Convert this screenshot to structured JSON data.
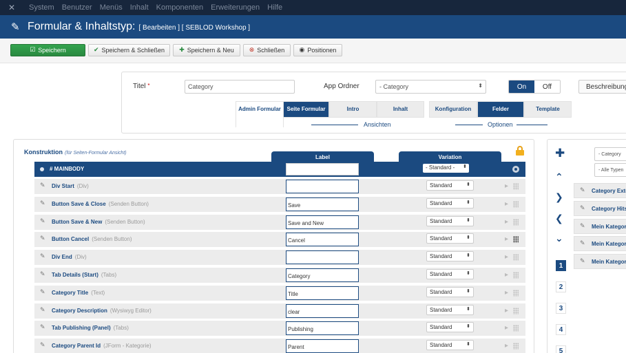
{
  "topnav": {
    "items": [
      "System",
      "Benutzer",
      "Menüs",
      "Inhalt",
      "Komponenten",
      "Erweiterungen",
      "Hilfe"
    ]
  },
  "header": {
    "icon": "pen-icon",
    "title": "Formular & Inhaltstyp:",
    "subtitle": "[ Bearbeiten ] [ SEBLOD Workshop ]"
  },
  "toolbar": {
    "save": "Speichern",
    "save_close": "Speichern & Schließen",
    "save_new": "Speichern & Neu",
    "close": "Schließen",
    "positions": "Positionen"
  },
  "form": {
    "title_label": "Titel",
    "title_required": "*",
    "title_value": "Category",
    "app_folder_label": "App Ordner",
    "app_folder_value": "- Category",
    "toggle_on": "On",
    "toggle_off": "Off",
    "description_button": "Beschreibung"
  },
  "views": {
    "tabs": [
      {
        "label": "Admin Formular",
        "active": false
      },
      {
        "label": "Seite Formular",
        "active": true
      },
      {
        "label": "Intro",
        "active": false
      },
      {
        "label": "Inhalt",
        "active": false
      }
    ],
    "group_label": "Ansichten"
  },
  "options": {
    "tabs": [
      {
        "label": "Konfiguration",
        "active": false
      },
      {
        "label": "Felder",
        "active": true
      },
      {
        "label": "Template",
        "active": false
      }
    ],
    "group_label": "Optionen"
  },
  "construction": {
    "title": "Konstruktion",
    "hint": "(für Seiten-Formular Ansicht)",
    "col_label": "Label",
    "col_variation": "Variation",
    "mainbody": {
      "name": "# MAINBODY",
      "variation": "- Standard -"
    },
    "rows": [
      {
        "name": "Div Start",
        "type": "(Div)",
        "label": "",
        "variation": "Standard"
      },
      {
        "name": "Button Save & Close",
        "type": "(Senden Button)",
        "label": "Save",
        "variation": "Standard"
      },
      {
        "name": "Button Save & New",
        "type": "(Senden Button)",
        "label": "Save and New",
        "variation": "Standard"
      },
      {
        "name": "Button Cancel",
        "type": "(Senden Button)",
        "label": "Cancel",
        "variation": "Standard"
      },
      {
        "name": "Div End",
        "type": "(Div)",
        "label": "",
        "variation": "Standard"
      },
      {
        "name": "Tab Details (Start)",
        "type": "(Tabs)",
        "label": "Category",
        "variation": "Standard"
      },
      {
        "name": "Category Title",
        "type": "(Text)",
        "label": "Title",
        "variation": "Standard"
      },
      {
        "name": "Category Description",
        "type": "(Wysiwyg Editor)",
        "label": "clear",
        "variation": "Standard"
      },
      {
        "name": "Tab Publishing (Panel)",
        "type": "(Tabs)",
        "label": "Publishing",
        "variation": "Standard"
      },
      {
        "name": "Category Parent Id",
        "type": "(JForm - Kategorie)",
        "label": "Parent",
        "variation": "Standard"
      }
    ]
  },
  "sidepanel": {
    "filter_category": "- Category",
    "filter_types": "- Alle Typen",
    "pages": [
      "1",
      "2",
      "3",
      "4",
      "5"
    ],
    "items": [
      "Category Extended",
      "Category Hits",
      "Mein Kategorie",
      "Mein Kategorie",
      "Mein Kategorie"
    ]
  },
  "colors": {
    "primary": "#1b4a80",
    "topnav": "#17263c",
    "save": "#2a8a40",
    "lock": "#f2b01e"
  }
}
